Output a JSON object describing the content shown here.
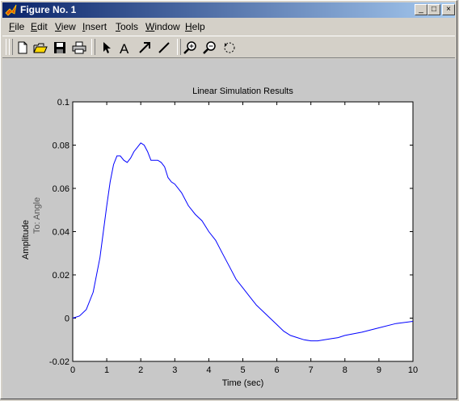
{
  "window": {
    "title": "Figure No. 1",
    "buttons": [
      "_",
      "□",
      "×"
    ]
  },
  "menu": [
    {
      "label": "File",
      "u": "F"
    },
    {
      "label": "Edit",
      "u": "E"
    },
    {
      "label": "View",
      "u": "V"
    },
    {
      "label": "Insert",
      "u": "I"
    },
    {
      "label": "Tools",
      "u": "T"
    },
    {
      "label": "Window",
      "u": "W"
    },
    {
      "label": "Help",
      "u": "H"
    }
  ],
  "toolbar": [
    "new-file-icon",
    "open-folder-icon",
    "save-icon",
    "print-icon",
    "pointer-arrow-icon",
    "text-insert-icon",
    "arrow-insert-icon",
    "line-insert-icon",
    "zoom-in-icon",
    "zoom-out-icon",
    "rotate-icon"
  ],
  "chart_data": {
    "type": "line",
    "title": "Linear Simulation Results",
    "xlabel": "Time (sec)",
    "ylabel": "Amplitude",
    "ylabel2": "To: Angle",
    "xlim": [
      0,
      10
    ],
    "ylim": [
      -0.02,
      0.1
    ],
    "xticks": [
      "0",
      "1",
      "2",
      "3",
      "4",
      "5",
      "6",
      "7",
      "8",
      "9",
      "10"
    ],
    "yticks": [
      "-0.02",
      "0",
      "0.02",
      "0.04",
      "0.06",
      "0.08",
      "0.1"
    ],
    "grid": false,
    "line_color": "#0000ff",
    "series": [
      {
        "x": [
          0,
          0.2,
          0.4,
          0.6,
          0.8,
          0.9,
          1.0,
          1.1,
          1.2,
          1.3,
          1.4,
          1.5,
          1.6,
          1.7,
          1.8,
          1.9,
          2.0,
          2.1,
          2.2,
          2.3,
          2.4,
          2.5,
          2.6,
          2.7,
          2.8,
          2.9,
          3.0,
          3.2,
          3.4,
          3.6,
          3.8,
          4.0,
          4.2,
          4.4,
          4.6,
          4.8,
          5.0,
          5.2,
          5.4,
          5.6,
          5.8,
          6.0,
          6.2,
          6.4,
          6.6,
          6.8,
          7.0,
          7.2,
          7.4,
          7.6,
          7.8,
          8.0,
          8.5,
          9.0,
          9.5,
          10.0
        ],
        "values": [
          0,
          0.001,
          0.004,
          0.012,
          0.028,
          0.04,
          0.052,
          0.063,
          0.071,
          0.075,
          0.075,
          0.073,
          0.072,
          0.074,
          0.077,
          0.079,
          0.081,
          0.08,
          0.077,
          0.073,
          0.073,
          0.073,
          0.072,
          0.07,
          0.065,
          0.063,
          0.062,
          0.058,
          0.052,
          0.048,
          0.045,
          0.04,
          0.036,
          0.03,
          0.024,
          0.018,
          0.014,
          0.01,
          0.006,
          0.003,
          0.0,
          -0.003,
          -0.006,
          -0.008,
          -0.009,
          -0.01,
          -0.0105,
          -0.0105,
          -0.01,
          -0.0095,
          -0.009,
          -0.008,
          -0.0065,
          -0.0045,
          -0.0025,
          -0.0015
        ]
      }
    ]
  }
}
